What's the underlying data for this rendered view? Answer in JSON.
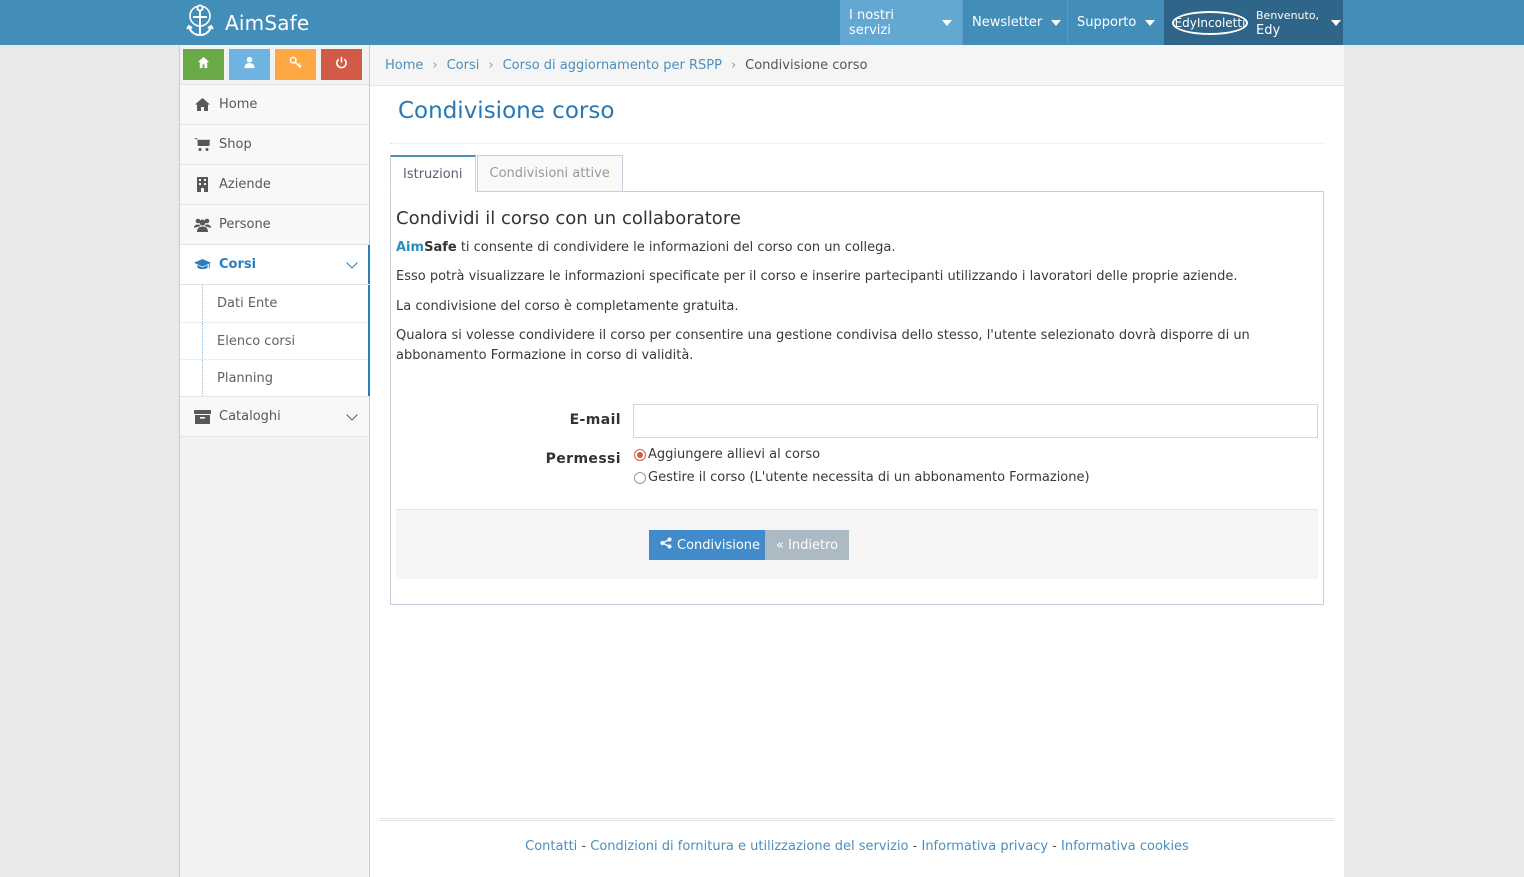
{
  "app": {
    "name": "AimSafe"
  },
  "navbar": {
    "items": [
      {
        "label": "I nostri servizi"
      },
      {
        "label": "Newsletter"
      },
      {
        "label": "Supporto"
      }
    ],
    "user": {
      "avatar_text": "EdyIncoletti",
      "welcome": "Benvenuto,",
      "name": "Edy"
    }
  },
  "sidebar": {
    "shortcuts": [
      {
        "icon": "home-icon",
        "color": "#69aa46"
      },
      {
        "icon": "user-icon",
        "color": "#6fb3e0"
      },
      {
        "icon": "key-icon",
        "color": "#fea743"
      },
      {
        "icon": "power-icon",
        "color": "#d15b47"
      }
    ],
    "items": [
      {
        "label": "Home",
        "icon": "home-icon"
      },
      {
        "label": "Shop",
        "icon": "cart-icon"
      },
      {
        "label": "Aziende",
        "icon": "building-icon"
      },
      {
        "label": "Persone",
        "icon": "users-icon"
      },
      {
        "label": "Corsi",
        "icon": "graduation-cap-icon",
        "active": true
      },
      {
        "label": "Cataloghi",
        "icon": "archive-icon"
      }
    ],
    "submenu": [
      {
        "label": "Dati Ente"
      },
      {
        "label": "Elenco corsi"
      },
      {
        "label": "Planning"
      }
    ]
  },
  "breadcrumb": {
    "items": [
      "Home",
      "Corsi",
      "Corso di aggiornamento per RSPP"
    ],
    "current": "Condivisione corso"
  },
  "page": {
    "title": "Condivisione corso",
    "tabs": [
      {
        "label": "Istruzioni",
        "active": true
      },
      {
        "label": "Condivisioni attive",
        "active": false
      }
    ],
    "content": {
      "heading": "Condividi il corso con un collaboratore",
      "brand_aim": "Aim",
      "brand_safe": "Safe",
      "p1_rest": " ti consente di condividere le informazioni del corso con un collega.",
      "p2": "Esso potrà visualizzare le informazioni specificate per il corso e inserire partecipanti utilizzando i lavoratori delle proprie aziende.",
      "p3": "La condivisione del corso è completamente gratuita.",
      "p4": "Qualora si volesse condividere il corso per consentire una gestione condivisa dello stesso, l'utente selezionato dovrà disporre di un abbonamento Formazione in corso di validità."
    },
    "form": {
      "email_label": "E-mail",
      "email_value": "",
      "permissions_label": "Permessi",
      "options": [
        {
          "label": "Aggiungere allievi al corso",
          "checked": true
        },
        {
          "label": "Gestire il corso (L'utente necessita di un abbonamento Formazione)",
          "checked": false
        }
      ],
      "share_button": "Condivisione",
      "back_button": "« Indietro"
    }
  },
  "footer": {
    "links": [
      "Contatti",
      "Condizioni di fornitura e utilizzazione del servizio",
      "Informativa privacy",
      "Informativa cookies"
    ],
    "separator": " - "
  },
  "colors": {
    "navbar": "#438eb9",
    "accent": "#2b7dbc",
    "share_button": "#428bca",
    "back_button": "#abbac3"
  }
}
